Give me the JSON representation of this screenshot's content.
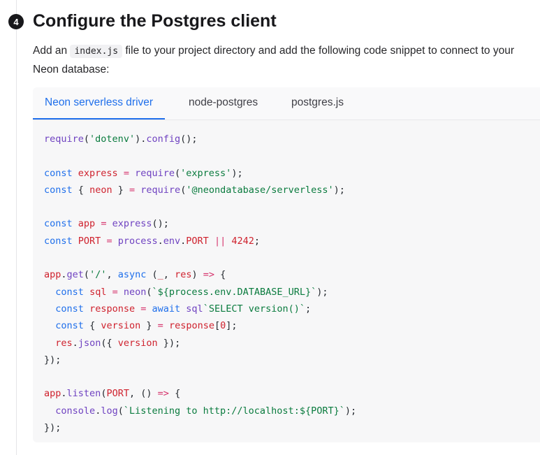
{
  "step": {
    "number": "4",
    "title": "Configure the Postgres client"
  },
  "intro": {
    "before": "Add an ",
    "code": "index.js",
    "after": " file to your project directory and add the following code snippet to connect to your Neon database:"
  },
  "tabs": [
    {
      "label": "Neon serverless driver",
      "active": true
    },
    {
      "label": "node-postgres",
      "active": false
    },
    {
      "label": "postgres.js",
      "active": false
    }
  ],
  "code_lines": [
    "require('dotenv').config();",
    "",
    "const express = require('express');",
    "const { neon } = require('@neondatabase/serverless');",
    "",
    "const app = express();",
    "const PORT = process.env.PORT || 4242;",
    "",
    "app.get('/', async (_, res) => {",
    "  const sql = neon(`${process.env.DATABASE_URL}`);",
    "  const response = await sql`SELECT version()`;",
    "  const { version } = response[0];",
    "  res.json({ version });",
    "});",
    "",
    "app.listen(PORT, () => {",
    "  console.log(`Listening to http://localhost:${PORT}`);",
    "});"
  ],
  "colors": {
    "accent": "#1f6feb",
    "code_background": "#f7f7f8",
    "string": "#0a7b3e",
    "function": "#6f42c1",
    "keyword": "#1f6feb",
    "variable": "#cf222e"
  }
}
